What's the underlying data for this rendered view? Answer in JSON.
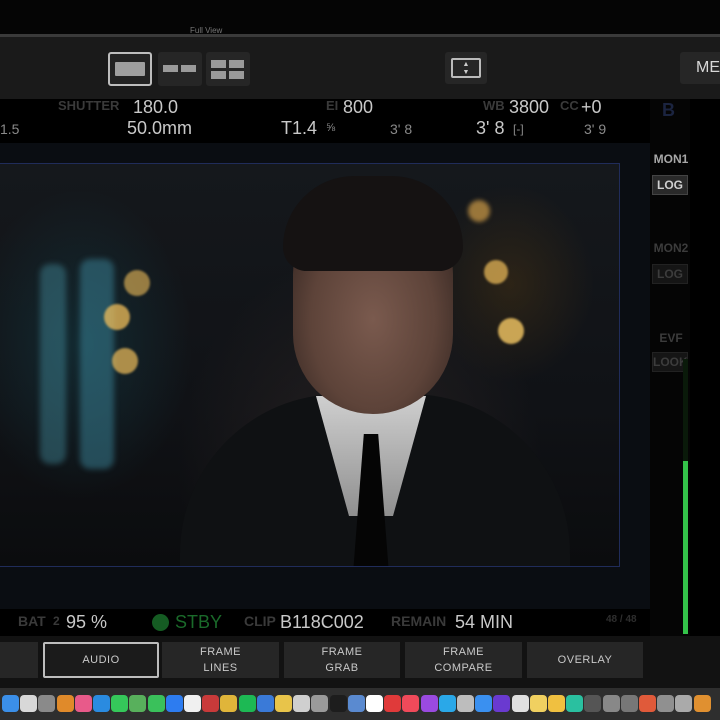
{
  "topbar": {
    "title": "Full View"
  },
  "toolbar": {
    "layouts": [
      "single-view",
      "dual-view",
      "quad-view"
    ],
    "menu_label": "MENU"
  },
  "hud": {
    "shutter_label": "SHUTTER",
    "shutter_value": "180.0",
    "ei_label": "EI",
    "ei_value": "800",
    "wb_label": "WB",
    "wb_value": "3800",
    "cc_label": "CC",
    "cc_value": "+0",
    "left_edge_value": "1.5",
    "focal_length": "50.0mm",
    "t_stop": "T1.4",
    "t_stop_fraction": "⅝",
    "focus_near": "3' 8",
    "focus_distance": "3' 8",
    "focus_unit": "[-]",
    "focus_far": "3' 9",
    "corner_badge": "B"
  },
  "side_rail": {
    "mon1_label": "MON1",
    "mon1_mode": "LOG",
    "mon2_label": "MON2",
    "mon2_mode": "LOG",
    "evf_label": "EVF",
    "evf_mode": "LOOK",
    "audio_level": 0.63,
    "audio_color": "#34c34a"
  },
  "status": {
    "battery_label": "BAT",
    "battery_slot": "2",
    "battery_value": "95 %",
    "record_state": "STBY",
    "clip_label": "CLIP",
    "clip_value": "B118C002",
    "remain_label": "REMAIN",
    "remain_value": "54 MIN",
    "corner_value": "48 / 48"
  },
  "controls": [
    {
      "id": "audio",
      "label": "AUDIO"
    },
    {
      "id": "frame-lines",
      "label": "FRAME\nLINES"
    },
    {
      "id": "frame-grab",
      "label": "FRAME\nGRAB"
    },
    {
      "id": "frame-compare",
      "label": "FRAME\nCOMPARE"
    },
    {
      "id": "overlay",
      "label": "OVERLAY"
    }
  ],
  "colors": {
    "accent_green": "#34c34a",
    "frame_line_blue": "#202c5a",
    "background": "#000000"
  },
  "dock": {
    "icons": [
      {
        "name": "finder-icon",
        "color": "#3b8fe8"
      },
      {
        "name": "launchpad-icon",
        "color": "#d8d8d8"
      },
      {
        "name": "system-prefs-icon",
        "color": "#8a8a8a"
      },
      {
        "name": "calculator-icon",
        "color": "#e08a2a"
      },
      {
        "name": "photos-icon",
        "color": "#e85a8a"
      },
      {
        "name": "safari-icon",
        "color": "#2a8be0"
      },
      {
        "name": "messages-icon",
        "color": "#35c85a"
      },
      {
        "name": "maps-icon",
        "color": "#58b05c"
      },
      {
        "name": "facetime-icon",
        "color": "#3ac15b"
      },
      {
        "name": "zoom-icon",
        "color": "#2d7cf0"
      },
      {
        "name": "calendar-icon",
        "color": "#f0f0f0"
      },
      {
        "name": "photobooth-icon",
        "color": "#c83a3a"
      },
      {
        "name": "chrome-icon",
        "color": "#e0b53a"
      },
      {
        "name": "spotify-icon",
        "color": "#1db954"
      },
      {
        "name": "files-icon",
        "color": "#3a7ad8"
      },
      {
        "name": "notes-icon",
        "color": "#e8c44a"
      },
      {
        "name": "document-icon",
        "color": "#cfcfcf"
      },
      {
        "name": "printer-icon",
        "color": "#9a9a9a"
      },
      {
        "name": "terminal-icon",
        "color": "#1d1d1d"
      },
      {
        "name": "preview-icon",
        "color": "#5a8ad0"
      },
      {
        "name": "star-icon",
        "color": "#ffffff"
      },
      {
        "name": "record-icon",
        "color": "#e03a3a"
      },
      {
        "name": "music-icon",
        "color": "#f04a5a"
      },
      {
        "name": "podcasts-icon",
        "color": "#9a4ae0"
      },
      {
        "name": "skype-icon",
        "color": "#2aa8e8"
      },
      {
        "name": "people-icon",
        "color": "#bdbdbd"
      },
      {
        "name": "app-store-icon",
        "color": "#3a90f0"
      },
      {
        "name": "word-icon",
        "color": "#6a3ad0"
      },
      {
        "name": "clock-icon",
        "color": "#e0e0e0"
      },
      {
        "name": "folder-icon",
        "color": "#f0d060"
      },
      {
        "name": "stickies-icon",
        "color": "#f0c040"
      },
      {
        "name": "globe-icon",
        "color": "#2ac0a0"
      },
      {
        "name": "monitor-icon",
        "color": "#555555"
      },
      {
        "name": "arrow-icon",
        "color": "#888888"
      },
      {
        "name": "settings-icon",
        "color": "#777777"
      },
      {
        "name": "colorsync-icon",
        "color": "#e05a3a"
      },
      {
        "name": "utility-icon",
        "color": "#909090"
      },
      {
        "name": "trash-icon",
        "color": "#aaaaaa"
      },
      {
        "name": "stats-icon",
        "color": "#e09030"
      }
    ]
  }
}
